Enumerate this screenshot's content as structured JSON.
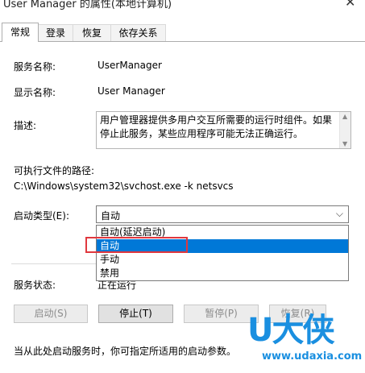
{
  "window": {
    "title": "User Manager 的属性(本地计算机)",
    "close_glyph": "✕"
  },
  "tabs": [
    {
      "label": "常规",
      "active": true
    },
    {
      "label": "登录",
      "active": false
    },
    {
      "label": "恢复",
      "active": false
    },
    {
      "label": "依存关系",
      "active": false
    }
  ],
  "general": {
    "service_name_label": "服务名称:",
    "service_name_value": "UserManager",
    "display_name_label": "显示名称:",
    "display_name_value": "User Manager",
    "description_label": "描述:",
    "description_value": "用户管理器提供多用户交互所需要的运行时组件。如果停止此服务，某些应用程序可能无法正确运行。",
    "path_label": "可执行文件的路径:",
    "path_value": "C:\\Windows\\system32\\svchost.exe -k netsvcs",
    "startup_type_label": "启动类型(E):",
    "startup_type_value": "自动",
    "startup_options": [
      "自动(延迟启动)",
      "自动",
      "手动",
      "禁用"
    ],
    "startup_selected_index": 1,
    "service_status_label": "服务状态:",
    "service_status_value": "正在运行",
    "buttons": {
      "start": "启动(S)",
      "stop": "停止(T)",
      "pause": "暂停(P)",
      "resume": "恢复(R)"
    },
    "start_params_hint": "当从此处启动服务时，你可指定所适用的启动参数。"
  },
  "watermark": {
    "logo_text": "U大侠",
    "url": "www.udaxia.com"
  },
  "colors": {
    "selection": "#0078d7",
    "highlight_box": "#e0383e",
    "watermark": "#1a8fe0"
  }
}
